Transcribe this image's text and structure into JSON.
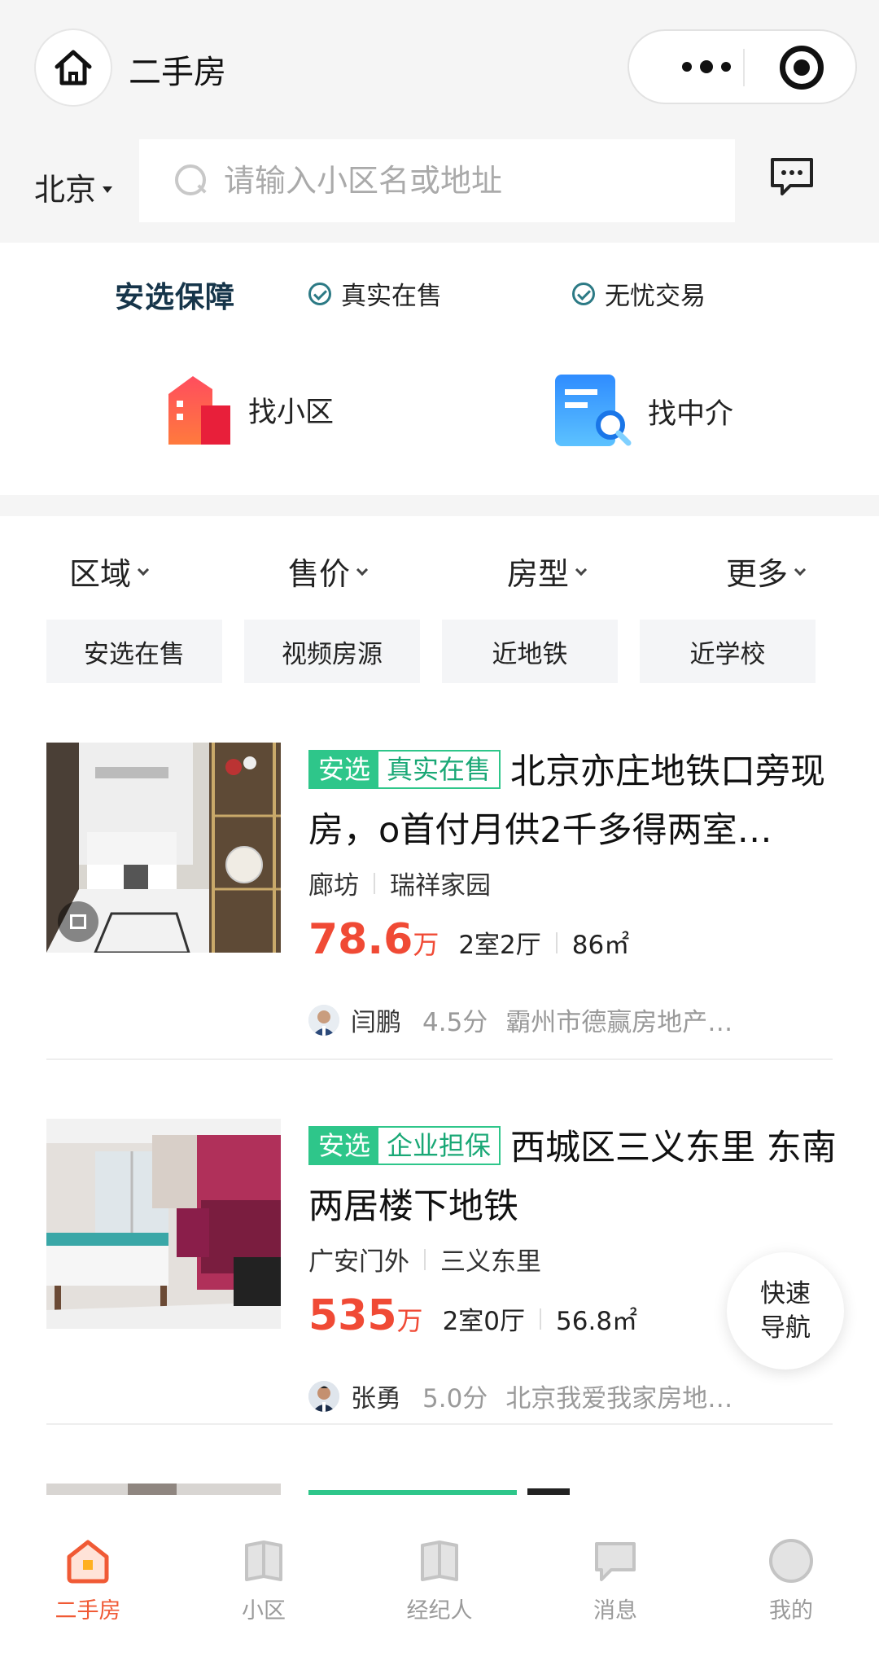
{
  "header": {
    "title": "二手房",
    "city": "北京",
    "search_placeholder": "请输入小区名或地址"
  },
  "guarantee": {
    "brand": "安选保障",
    "items": [
      "真实在售",
      "无忧交易"
    ]
  },
  "features": [
    {
      "label": "找小区",
      "icon": "building-icon"
    },
    {
      "label": "找中介",
      "icon": "agent-search-icon"
    }
  ],
  "filters": [
    "区域",
    "售价",
    "房型",
    "更多"
  ],
  "chips": [
    "安选在售",
    "视频房源",
    "近地铁",
    "近学校"
  ],
  "listings": [
    {
      "tag_a": "安选",
      "tag_b": "真实在售",
      "title": "北京亦庄地铁口旁现房，o首付月供2千多得两室…",
      "district": "廊坊",
      "community": "瑞祥家园",
      "price": "78.6",
      "unit": "万",
      "layout": "2室2厅",
      "area": "86㎡",
      "agent_name": "闫鹏",
      "agent_score": "4.5分",
      "agent_company": "霸州市德赢房地产…"
    },
    {
      "tag_a": "安选",
      "tag_b": "企业担保",
      "title": "西城区三义东里 东南两居楼下地铁",
      "district": "广安门外",
      "community": "三义东里",
      "price": "535",
      "unit": "万",
      "layout": "2室0厅",
      "area": "56.8㎡",
      "agent_name": "张勇",
      "agent_score": "5.0分",
      "agent_company": "北京我爱我家房地…"
    }
  ],
  "quick_nav": [
    "快速",
    "导航"
  ],
  "tabbar": [
    {
      "label": "二手房",
      "active": true
    },
    {
      "label": "小区",
      "active": false
    },
    {
      "label": "经纪人",
      "active": false
    },
    {
      "label": "消息",
      "active": false
    },
    {
      "label": "我的",
      "active": false
    }
  ],
  "colors": {
    "accent": "#f05a35",
    "price": "#f04a35",
    "tag_green": "#2ec68a",
    "brand_dark": "#16354a"
  }
}
